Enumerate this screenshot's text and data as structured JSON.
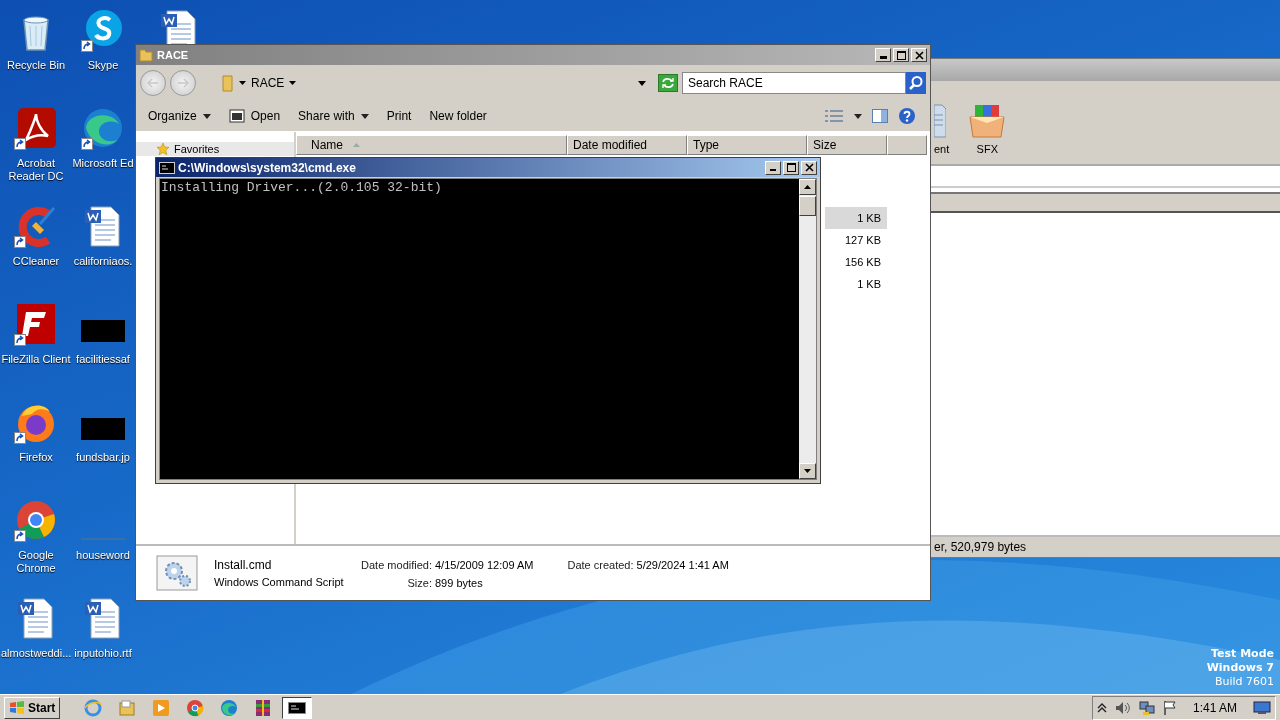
{
  "desktop": {
    "icons": [
      {
        "label": "Recycle Bin",
        "kind": "bin",
        "shortcut": false
      },
      {
        "label": "Acrobat Reader DC",
        "kind": "acrobat",
        "shortcut": true
      },
      {
        "label": "CCleaner",
        "kind": "ccleaner",
        "shortcut": true
      },
      {
        "label": "FileZilla Client",
        "kind": "filezilla",
        "shortcut": true
      },
      {
        "label": "Firefox",
        "kind": "firefox",
        "shortcut": true
      },
      {
        "label": "Google Chrome",
        "kind": "chrome",
        "shortcut": true
      },
      {
        "label": "almostweddi...",
        "kind": "word",
        "shortcut": false
      },
      {
        "label": "Skype",
        "kind": "skype",
        "shortcut": true
      },
      {
        "label": "Microsoft Ed",
        "kind": "edge",
        "shortcut": true
      },
      {
        "label": "californiaos.",
        "kind": "word",
        "shortcut": false
      },
      {
        "label": "facilitiessaf",
        "kind": "image",
        "shortcut": false
      },
      {
        "label": "fundsbar.jp",
        "kind": "image",
        "shortcut": false
      },
      {
        "label": "houseword",
        "kind": "blank",
        "shortcut": false
      },
      {
        "label": "inputohio.rtf",
        "kind": "word",
        "shortcut": false
      },
      {
        "kind": "word",
        "shortcut": false
      }
    ],
    "os_notice": [
      "Test Mode",
      "Windows 7",
      "Build 7601"
    ]
  },
  "background_window": {
    "toolbar": [
      {
        "label": "ent",
        "kind": "document"
      },
      {
        "label": "SFX",
        "kind": "archive"
      }
    ],
    "status_bar": "er, 520,979 bytes"
  },
  "explorer": {
    "title": "RACE",
    "address": "RACE",
    "search": {
      "placeholder": "Search RACE"
    },
    "toolbar": [
      {
        "label": "Organize",
        "kind": "menu"
      },
      {
        "label": "Open",
        "kind": "icon"
      },
      {
        "label": "Share with",
        "kind": "menu"
      },
      {
        "label": "Print",
        "kind": "plain"
      },
      {
        "label": "New folder",
        "kind": "plain"
      }
    ],
    "nav": [
      {
        "label": "Favorites"
      }
    ],
    "columns": [
      {
        "label": "Name",
        "sorted": true
      },
      {
        "label": "Date modified",
        "sorted": false
      },
      {
        "label": "Type",
        "sorted": false
      },
      {
        "label": "Size",
        "sorted": false
      }
    ],
    "rows": [
      {
        "size": "1 KB",
        "selected": true
      },
      {
        "size": "127 KB",
        "selected": false
      },
      {
        "size": "156 KB",
        "selected": false
      },
      {
        "size": "1 KB",
        "selected": false
      }
    ],
    "details": {
      "name": "Install.cmd",
      "type": "Windows Command Script",
      "fields": [
        {
          "label": "Date modified:",
          "value": "4/15/2009 12:09 AM"
        },
        {
          "label": "Size:",
          "value": "899 bytes"
        },
        {
          "label": "Date created:",
          "value": "5/29/2024 1:41 AM"
        }
      ]
    }
  },
  "cmd": {
    "title": "C:\\Windows\\system32\\cmd.exe",
    "lines": [
      "Installing Driver...(2.0.105 32-bit)"
    ]
  },
  "taskbar": {
    "start": "Start",
    "apps": [
      {
        "kind": "ie",
        "active": false
      },
      {
        "kind": "explorer",
        "active": false
      },
      {
        "kind": "media",
        "active": false
      },
      {
        "kind": "chrome",
        "active": false
      },
      {
        "kind": "edge",
        "active": false
      },
      {
        "kind": "winrar",
        "active": false
      },
      {
        "kind": "cmd",
        "active": true
      }
    ],
    "clock": "1:41 AM"
  }
}
